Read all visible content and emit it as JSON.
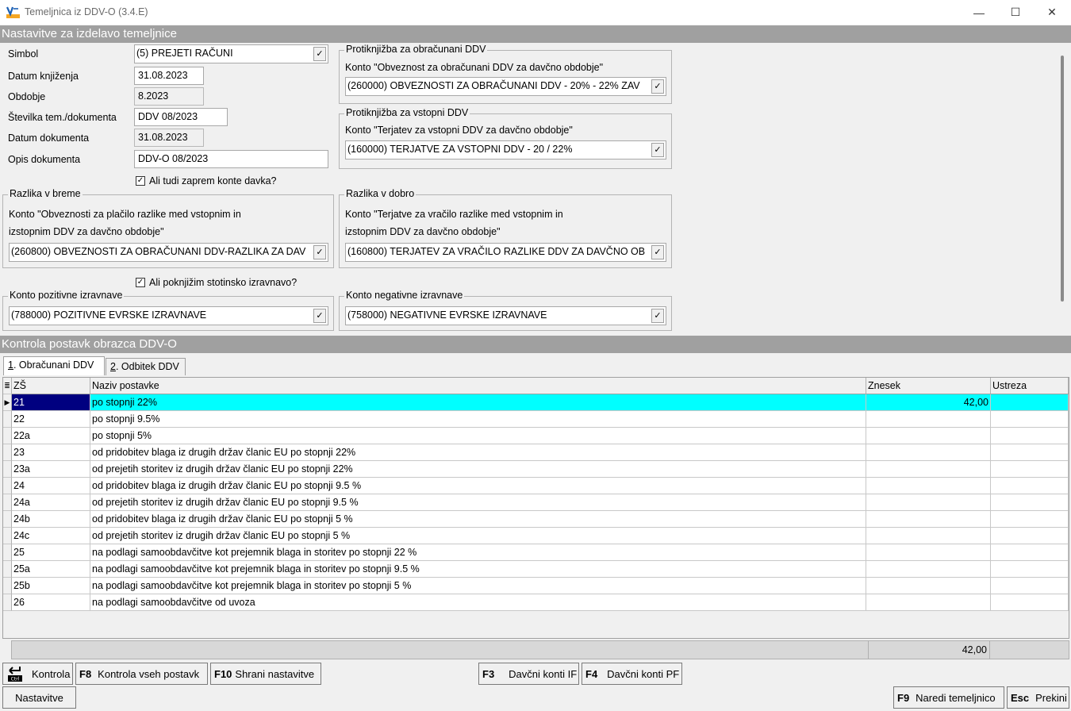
{
  "window": {
    "title": "Temeljnica iz DDV-O  (3.4.E)",
    "minimize": "—",
    "maximize": "☐",
    "close": "✕"
  },
  "settings": {
    "header": "Nastavitve za izdelavo temeljnice",
    "simbol": {
      "label": "Simbol",
      "value": "(5) PREJETI RAČUNI"
    },
    "datum_knjizenja": {
      "label": "Datum knjiženja",
      "value": "31.08.2023"
    },
    "obdobje": {
      "label": "Obdobje",
      "value": "8.2023"
    },
    "stevilka": {
      "label": "Številka tem./dokumenta",
      "value": "DDV 08/2023"
    },
    "datum_dokumenta": {
      "label": "Datum dokumenta",
      "value": "31.08.2023"
    },
    "opis": {
      "label": "Opis dokumenta",
      "value": "DDV-O 08/2023"
    },
    "zaprem_konte": {
      "label": "Ali tudi zaprem konte davka?",
      "checked": true
    },
    "protiknjizba_obracunani": {
      "title": "Protiknjižba za obračunani DDV",
      "desc": "Konto \"Obveznost za obračunani DDV za davčno obdobje\"",
      "value": "(260000) OBVEZNOSTI ZA OBRAČUNANI DDV - 20% - 22% ZAV"
    },
    "protiknjizba_vstopni": {
      "title": "Protiknjižba za vstopni DDV",
      "desc": "Konto \"Terjatev za vstopni DDV za davčno obdobje\"",
      "value": "(160000) TERJATVE ZA VSTOPNI DDV - 20 / 22%"
    },
    "razlika_breme": {
      "title": "Razlika v breme",
      "desc1": "Konto \"Obveznosti za plačilo razlike med vstopnim in",
      "desc2": "izstopnim DDV za davčno obdobje\"",
      "value": "(260800) OBVEZNOSTI ZA OBRAČUNANI DDV-RAZLIKA ZA DAV"
    },
    "razlika_dobro": {
      "title": "Razlika v dobro",
      "desc1": "Konto \"Terjatve za vračilo razlike med vstopnim in",
      "desc2": "izstopnim DDV za davčno obdobje\"",
      "value": "(160800) TERJATEV ZA VRAČILO RAZLIKE DDV ZA DAVČNO OB"
    },
    "stotinsko": {
      "label": "Ali poknjižim stotinsko izravnavo?",
      "checked": true
    },
    "konto_pozitivne": {
      "title": "Konto pozitivne izravnave",
      "value": "(788000) POZITIVNE EVRSKE IZRAVNAVE"
    },
    "konto_negativne": {
      "title": "Konto negativne izravnave",
      "value": "(758000) NEGATIVNE EVRSKE IZRAVNAVE"
    },
    "check_mark": "✓",
    "combo_mark": "✓"
  },
  "control": {
    "header": "Kontrola postavk obrazca DDV-O",
    "tabs": [
      {
        "key": "1",
        "label": ". Obračunani DDV"
      },
      {
        "key": "2",
        "label": ". Odbitek DDV"
      }
    ],
    "columns": [
      "ZŠ",
      "Naziv postavke",
      "Znesek",
      "Ustreza"
    ],
    "rows": [
      {
        "zs": "21",
        "naziv": "po stopnji 22%",
        "znesek": "42,00",
        "ustreza": ""
      },
      {
        "zs": "22",
        "naziv": "po stopnji 9.5%",
        "znesek": "",
        "ustreza": ""
      },
      {
        "zs": "22a",
        "naziv": "po stopnji 5%",
        "znesek": "",
        "ustreza": ""
      },
      {
        "zs": "23",
        "naziv": "od pridobitev blaga iz drugih držav članic EU po stopnji 22%",
        "znesek": "",
        "ustreza": ""
      },
      {
        "zs": "23a",
        "naziv": "od prejetih storitev iz drugih držav članic EU po stopnji 22%",
        "znesek": "",
        "ustreza": ""
      },
      {
        "zs": "24",
        "naziv": "od pridobitev blaga iz drugih držav članic EU po stopnji 9.5 %",
        "znesek": "",
        "ustreza": ""
      },
      {
        "zs": "24a",
        "naziv": "od prejetih storitev iz drugih držav članic EU po stopnji 9.5 %",
        "znesek": "",
        "ustreza": ""
      },
      {
        "zs": "24b",
        "naziv": "od pridobitev blaga iz drugih držav članic EU po stopnji 5 %",
        "znesek": "",
        "ustreza": ""
      },
      {
        "zs": "24c",
        "naziv": "od prejetih storitev iz drugih držav članic EU po stopnji 5 %",
        "znesek": "",
        "ustreza": ""
      },
      {
        "zs": "25",
        "naziv": "na podlagi samoobdavčitve kot prejemnik blaga in storitev po stopnji 22 %",
        "znesek": "",
        "ustreza": ""
      },
      {
        "zs": "25a",
        "naziv": "na podlagi samoobdavčitve kot prejemnik blaga in storitev po stopnji 9.5 %",
        "znesek": "",
        "ustreza": ""
      },
      {
        "zs": "25b",
        "naziv": "na podlagi samoobdavčitve kot prejemnik blaga in storitev po stopnji 5 %",
        "znesek": "",
        "ustreza": ""
      },
      {
        "zs": "26",
        "naziv": "na podlagi samoobdavčitve od uvoza",
        "znesek": "",
        "ustreza": ""
      }
    ],
    "total": "42,00",
    "selected_row_color": "#00ffff",
    "selected_cell_color": "#000080"
  },
  "buttons": {
    "kontrola": {
      "icon": "ctrl-enter-icon",
      "icon_text": "Ctrl",
      "label": "Kontrola"
    },
    "kontrola_vseh": {
      "key": "F8",
      "label": "Kontrola vseh postavk"
    },
    "shrani": {
      "key": "F10",
      "label": "Shrani nastavitve"
    },
    "davcni_if": {
      "key": "F3",
      "label": "Davčni konti IF"
    },
    "davcni_pf": {
      "key": "F4",
      "label": "Davčni konti PF"
    },
    "nastavitve": {
      "label": "Nastavitve"
    },
    "naredi": {
      "key": "F9",
      "label": "Naredi temeljnico"
    },
    "prekini": {
      "key": "Esc",
      "label": "Prekini"
    }
  }
}
